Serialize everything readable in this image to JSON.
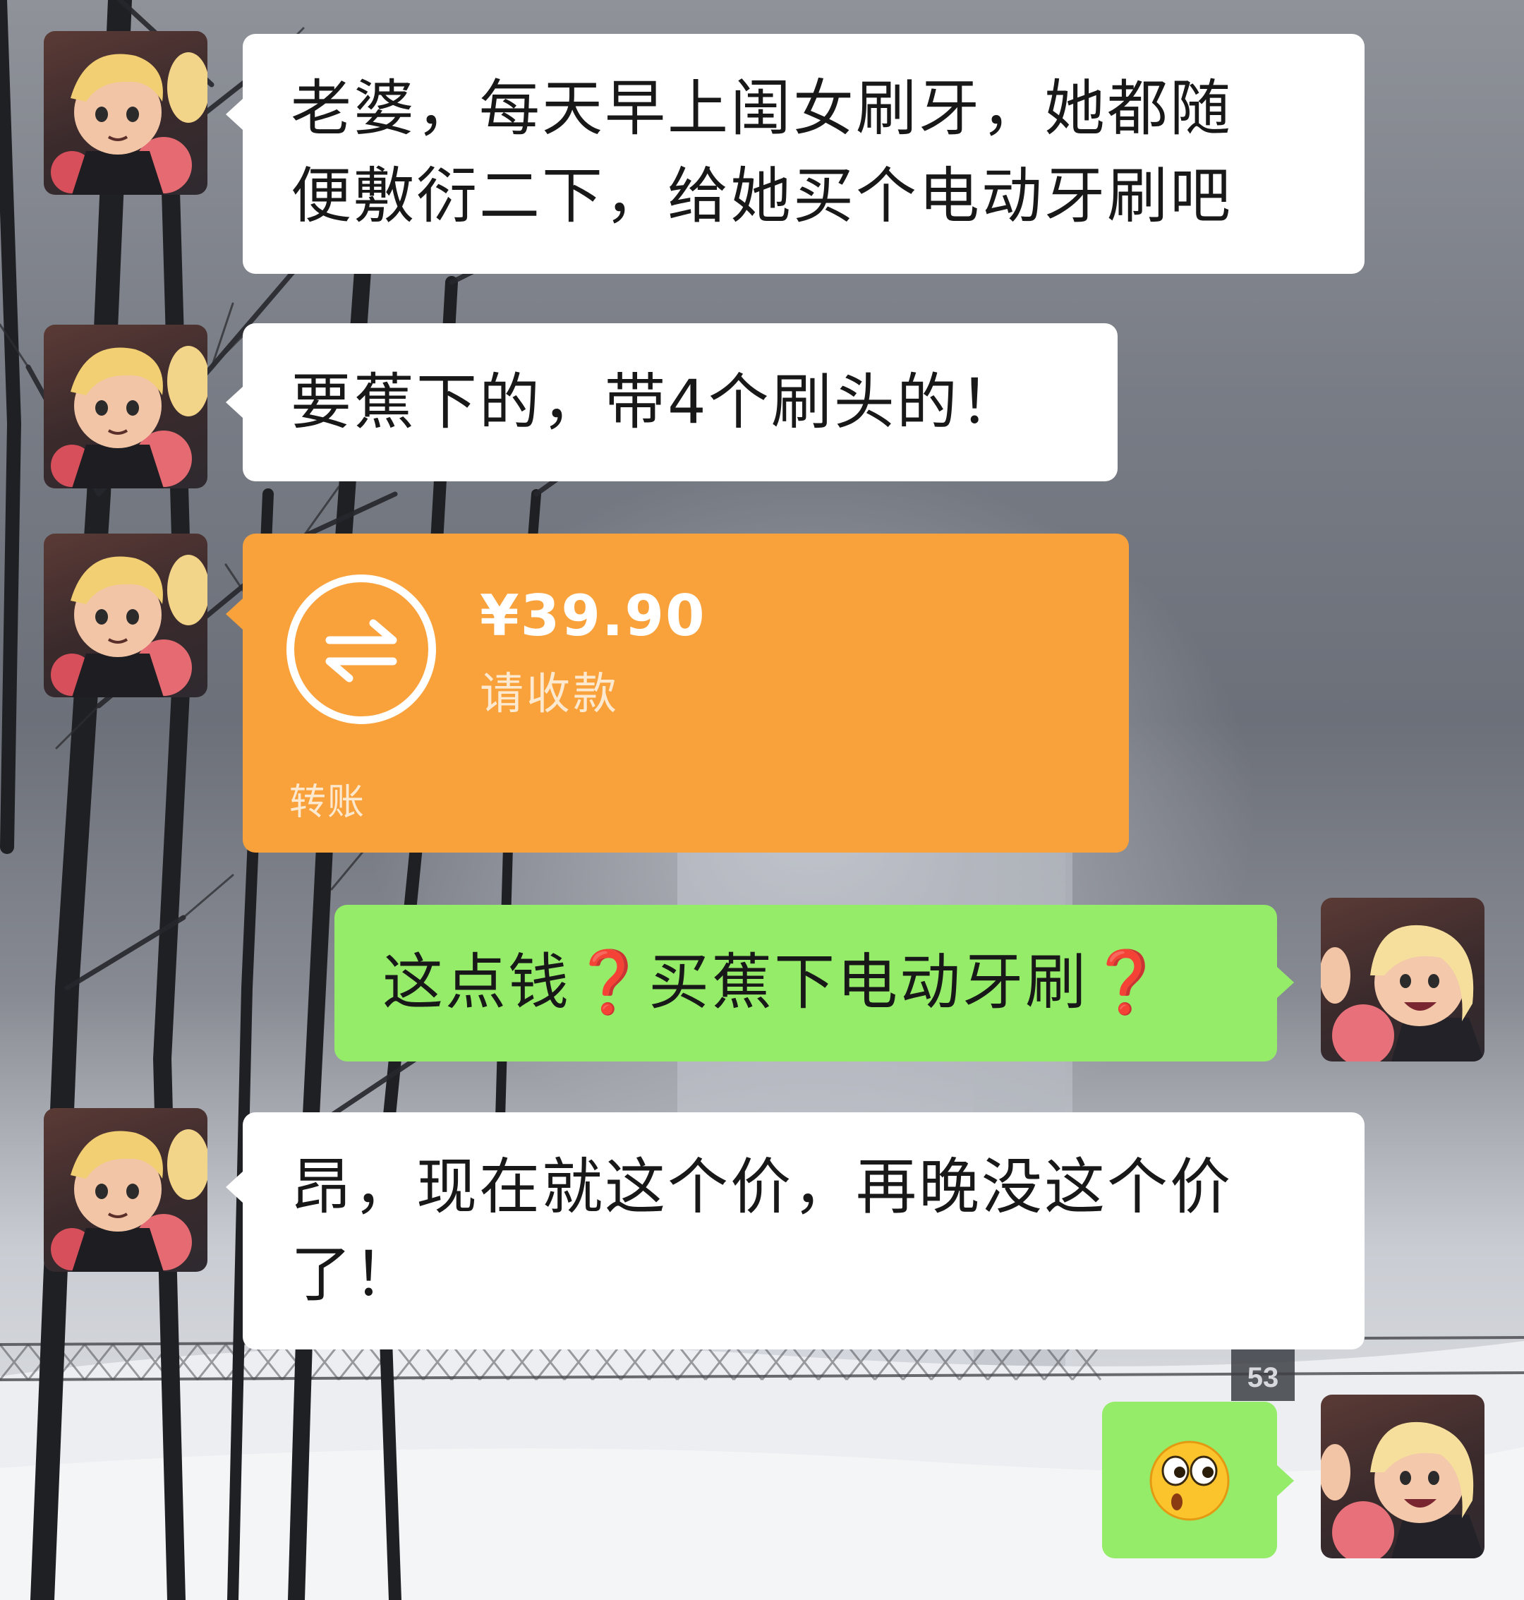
{
  "chat": {
    "messages": [
      {
        "sender": "other",
        "type": "text",
        "lines": [
          "老婆，每天早上闺女刷牙，她都随",
          "便敷衍二下，给她买个电动牙刷吧"
        ]
      },
      {
        "sender": "other",
        "type": "text",
        "lines": [
          "要蕉下的，带4个刷头的！"
        ]
      },
      {
        "sender": "other",
        "type": "transfer",
        "amount": "¥39.90",
        "status": "请收款",
        "label": "转账"
      },
      {
        "sender": "self",
        "type": "text",
        "parts": [
          "这点钱",
          "❓",
          "买蕉下电动牙刷",
          "❓"
        ]
      },
      {
        "sender": "other",
        "type": "text",
        "lines": [
          "昂，现在就这个价，再晚没这个价",
          "了！"
        ]
      },
      {
        "sender": "self",
        "type": "emoji",
        "emoji": "surprised-face-emoji"
      }
    ],
    "background": {
      "sign_number": "53"
    }
  },
  "avatars": {
    "other": "avatar-boy-icon",
    "self": "avatar-girl-icon"
  },
  "colors": {
    "bubble_white": "#ffffff",
    "bubble_self": "#95ec69",
    "transfer_orange": "#f9a13b",
    "question_mark": "#e0201f"
  }
}
